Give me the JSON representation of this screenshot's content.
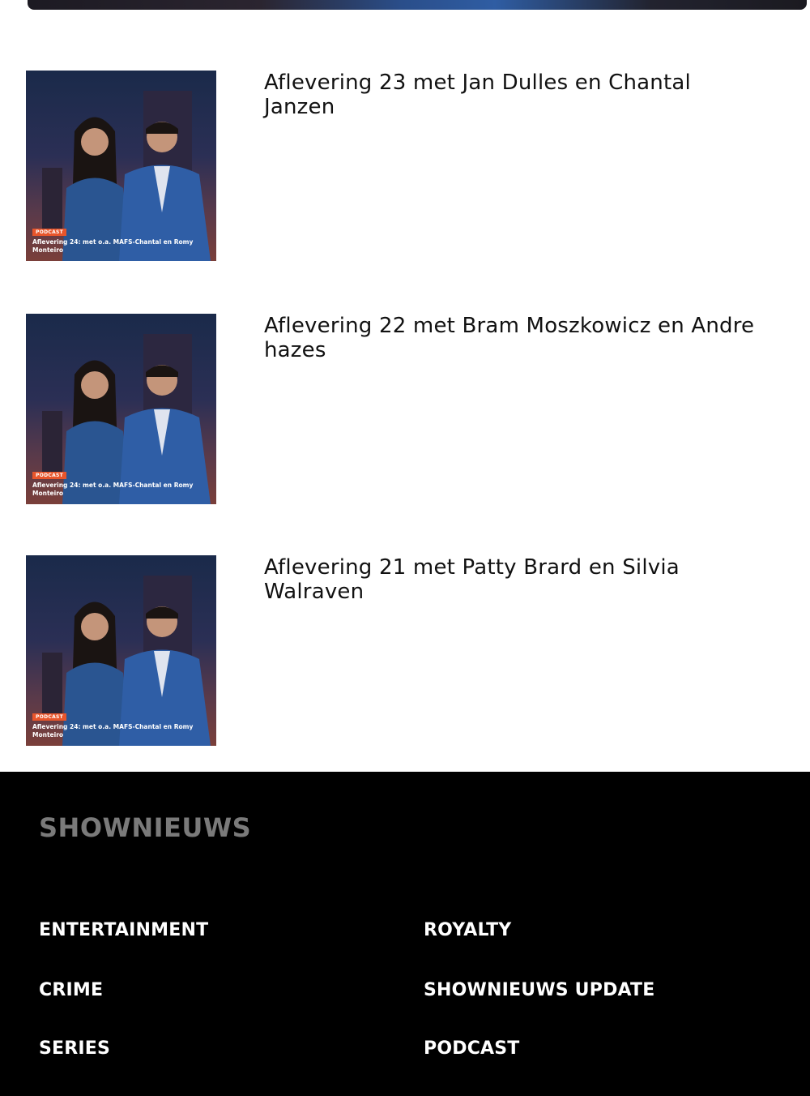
{
  "episodes": [
    {
      "title": "Aflevering 23 met Jan Dulles en Chantal Janzen",
      "thumb_tag": "PODCAST",
      "thumb_caption": "Aflevering 24: met o.a. MAFS-Chantal en Romy Monteiro"
    },
    {
      "title": "Aflevering 22 met Bram Moszkowicz en Andre hazes",
      "thumb_tag": "PODCAST",
      "thumb_caption": "Aflevering 24: met o.a. MAFS-Chantal en Romy Monteiro"
    },
    {
      "title": "Aflevering 21 met Patty Brard en Silvia Walraven",
      "thumb_tag": "PODCAST",
      "thumb_caption": "Aflevering 24: met o.a. MAFS-Chantal en Romy Monteiro"
    }
  ],
  "footer": {
    "brand": "SHOWNIEUWS",
    "links": [
      "ENTERTAINMENT",
      "ROYALTY",
      "CRIME",
      "SHOWNIEUWS UPDATE",
      "SERIES",
      "PODCAST"
    ]
  },
  "colors": {
    "footer_bg": "#000000",
    "footer_brand": "#7a7a7a",
    "tag_accent": "#e8552b"
  }
}
